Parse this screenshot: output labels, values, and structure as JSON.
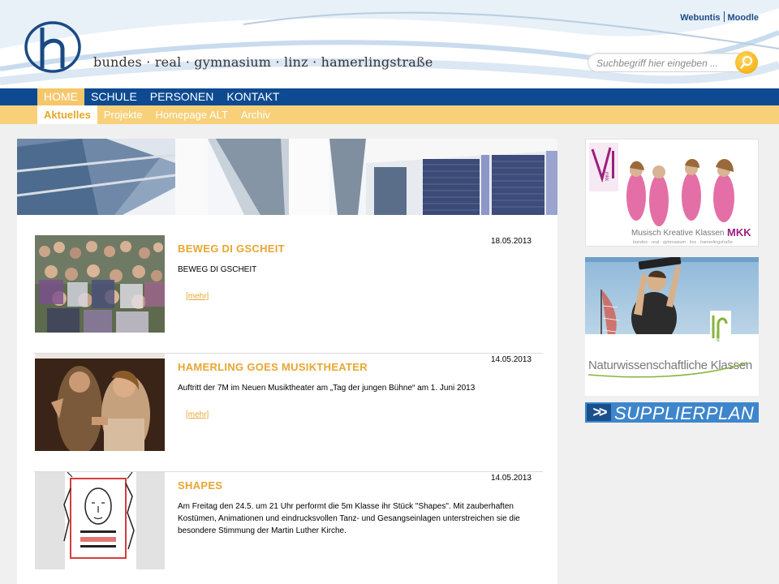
{
  "header": {
    "school_name": "bundes · real · gymnasium · linz · hamerlingstraße",
    "top_links": [
      "Webuntis",
      "Moodle"
    ],
    "search_placeholder": "Suchbegriff hier eingeben ..."
  },
  "main_nav": [
    "HOME",
    "SCHULE",
    "PERSONEN",
    "KONTAKT"
  ],
  "sub_nav": [
    "Aktuelles",
    "Projekte",
    "Homepage ALT",
    "Archiv"
  ],
  "news": [
    {
      "title": "BEWEG DI GSCHEIT",
      "date": "18.05.2013",
      "text": "BEWEG DI GSCHEIT",
      "more": "[mehr]"
    },
    {
      "title": "HAMERLING GOES MUSIKTHEATER",
      "date": "14.05.2013",
      "text": "Auftritt der 7M im Neuen Musiktheater am „Tag der jungen Bühne“ am 1. Juni 2013",
      "more": "[mehr]"
    },
    {
      "title": "SHAPES",
      "date": "14.05.2013",
      "text": "Am Freitag den 24.5. um 21 Uhr performt die 5m Klasse ihr Stück \"Shapes\". Mit zauberhaften Kostümen, Animationen und eindrucksvollen Tanz- und Gesangseinlagen unterstreichen sie die besondere Stimmung der Martin Luther Kirche.",
      "more": ""
    }
  ],
  "sidebar": {
    "mkk_logo_letters": "mkk",
    "mkk_caption": "Musisch Kreative Klassen",
    "mkk_tag": "MKK",
    "mkk_sub": "bundes · real · gymnasium · linz · hamerlingstraße",
    "nawi_logo_letters": "nawi",
    "nawi_caption": "Naturwissenschaftliche Klassen",
    "supplierplan_arrows": ">>",
    "supplierplan_label": "SUPPLIERPLAN"
  },
  "colors": {
    "nav_blue": "#0d4a91",
    "subnav_yellow": "#f7d079",
    "accent_orange": "#e7a632",
    "link_blue": "#1e4a86"
  }
}
